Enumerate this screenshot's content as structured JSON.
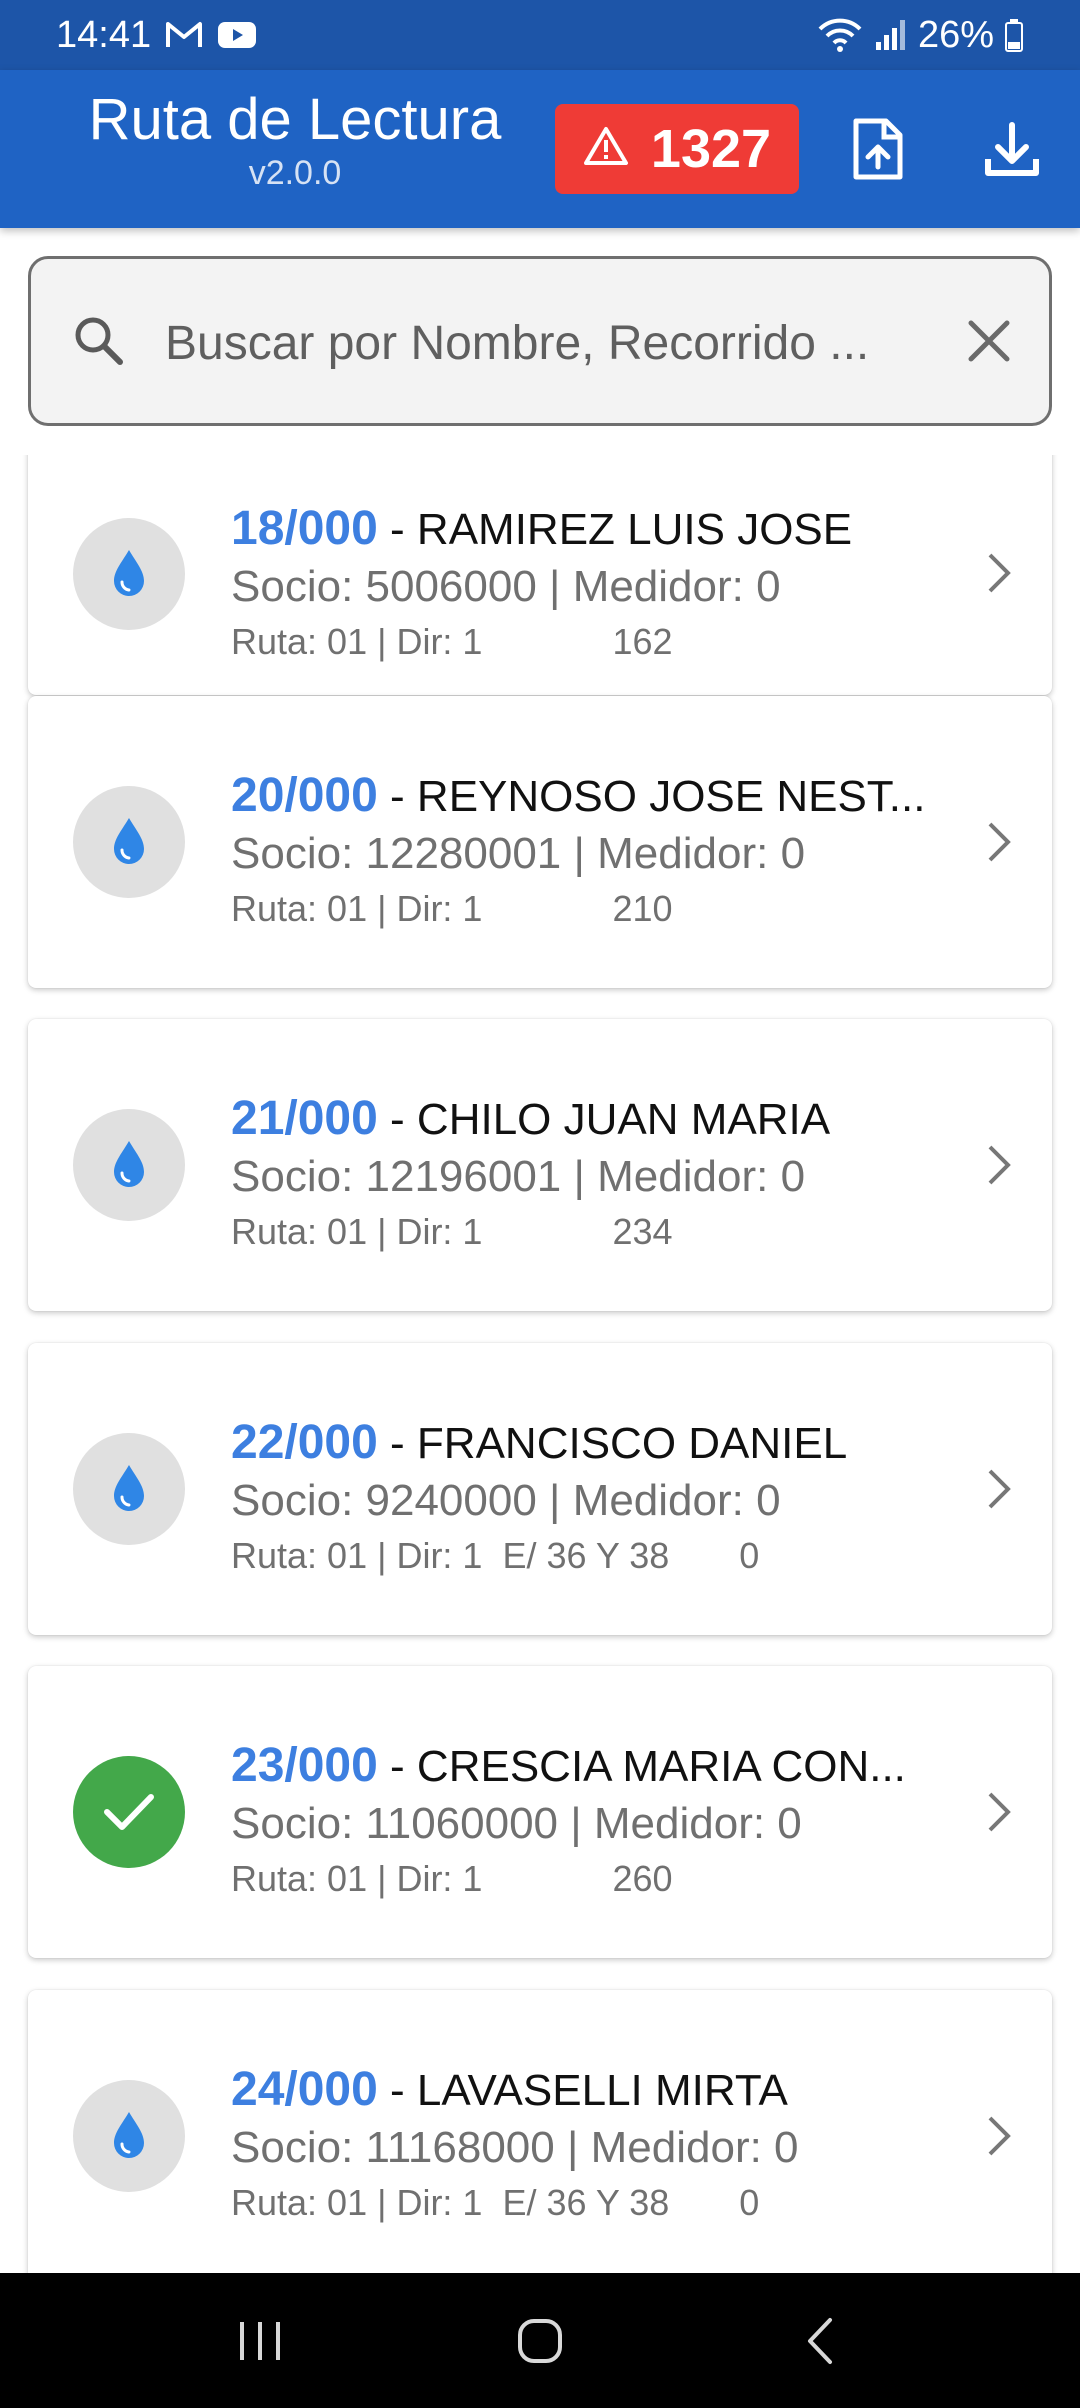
{
  "status_bar": {
    "time": "14:41",
    "battery": "26%",
    "icons": [
      "gmail-icon",
      "youtube-icon",
      "wifi-icon",
      "signal-icon",
      "battery-icon"
    ]
  },
  "app_bar": {
    "title": "Ruta de Lectura",
    "version": "v2.0.0",
    "alert_count": "1327",
    "alert_color": "#ef3b36",
    "bar_color": "#1f63c4",
    "actions": [
      "upload-file-icon",
      "download-icon"
    ]
  },
  "search": {
    "placeholder": "Buscar por Nombre, Recorrido ...",
    "value": ""
  },
  "records": [
    {
      "code": "18/000",
      "name": "- RAMIREZ LUIS JOSE",
      "socio": "Socio: 5006000 | Medidor: 0",
      "ruta": "Ruta: 01 | Dir: 1             162",
      "status": "pending"
    },
    {
      "code": "20/000",
      "name": "- REYNOSO JOSE NEST...",
      "socio": "Socio: 12280001 | Medidor: 0",
      "ruta": "Ruta: 01 | Dir: 1             210",
      "status": "pending"
    },
    {
      "code": "21/000",
      "name": "- CHILO JUAN MARIA",
      "socio": "Socio: 12196001 | Medidor: 0",
      "ruta": "Ruta: 01 | Dir: 1             234",
      "status": "pending"
    },
    {
      "code": "22/000",
      "name": "- FRANCISCO DANIEL",
      "socio": "Socio: 9240000 | Medidor: 0",
      "ruta": "Ruta: 01 | Dir: 1  E/ 36 Y 38       0",
      "status": "pending"
    },
    {
      "code": "23/000",
      "name": "- CRESCIA MARIA CON...",
      "socio": "Socio: 11060000 | Medidor: 0",
      "ruta": "Ruta: 01 | Dir: 1             260",
      "status": "done"
    },
    {
      "code": "24/000",
      "name": "- LAVASELLI MIRTA",
      "socio": "Socio: 11168000 | Medidor: 0",
      "ruta": "Ruta: 01 | Dir: 1  E/ 36 Y 38       0",
      "status": "pending"
    }
  ],
  "colors": {
    "code_blue": "#3d7fe0",
    "water_drop": "#2f86e6",
    "done_green": "#43a84a"
  }
}
